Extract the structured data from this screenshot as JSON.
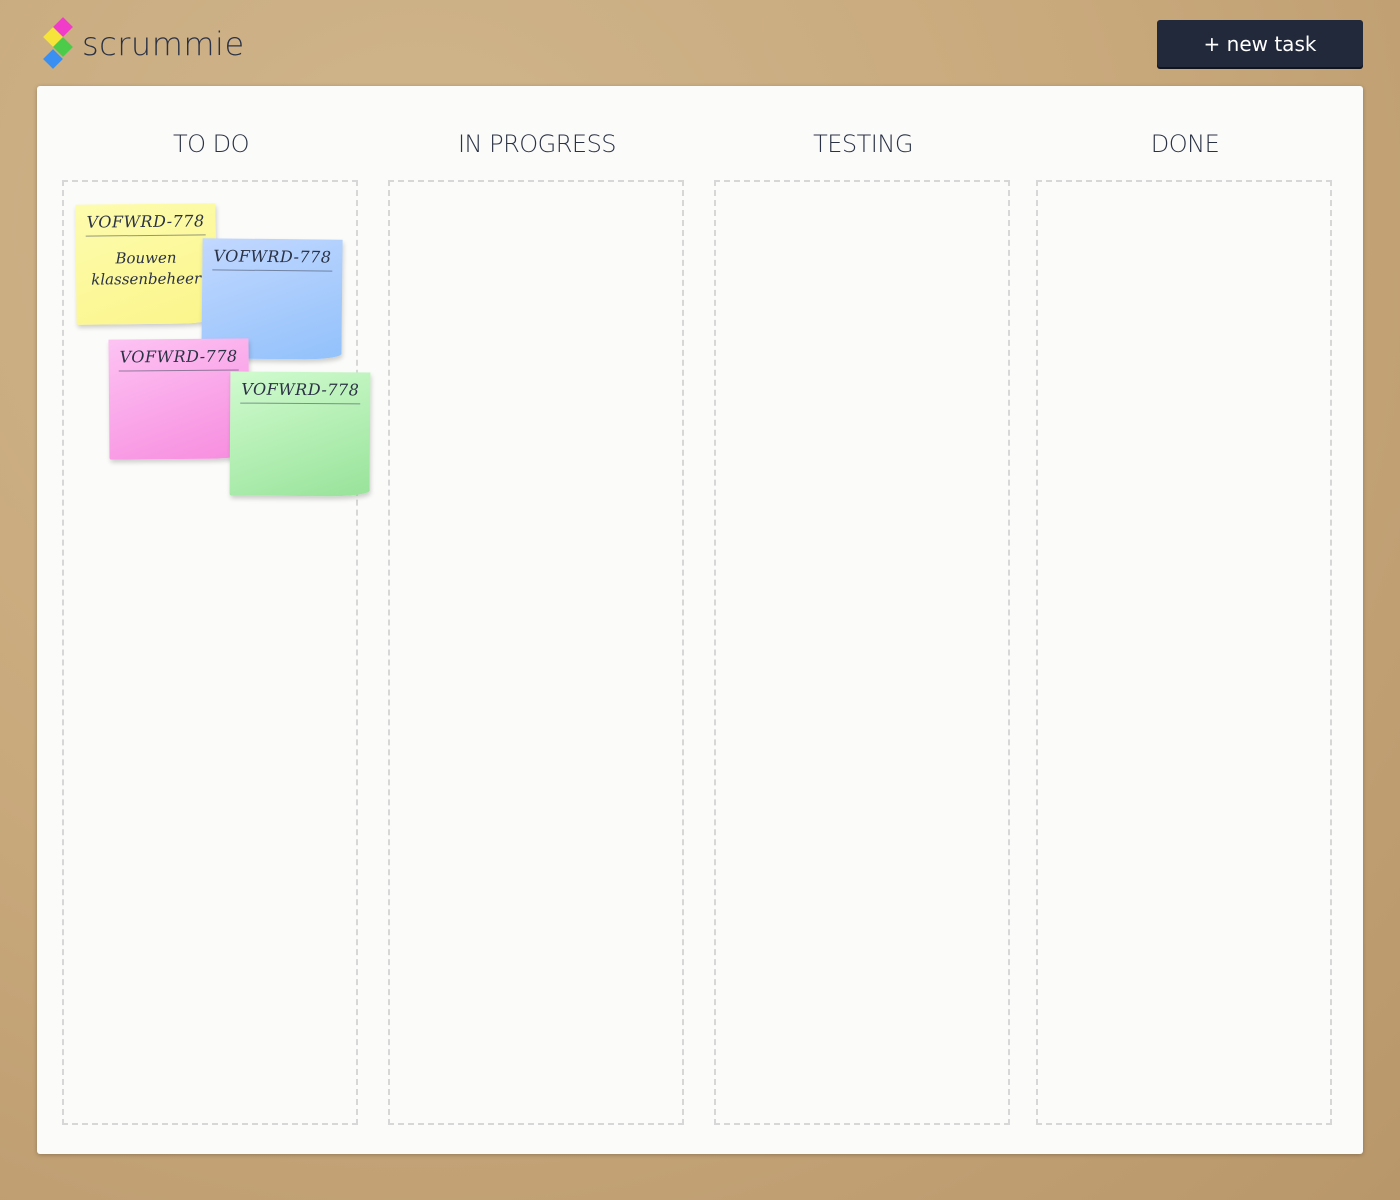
{
  "app": {
    "name": "scrummie",
    "new_task_label": "+ new task"
  },
  "columns": [
    {
      "title": "TO DO"
    },
    {
      "title": "IN PROGRESS"
    },
    {
      "title": "TESTING"
    },
    {
      "title": "DONE"
    }
  ],
  "notes": [
    {
      "id": "VOFWRD-778",
      "text": "Bouwen klassenbeheer",
      "color": "#fbf58a"
    },
    {
      "id": "VOFWRD-778",
      "text": "",
      "color": "#92c1fb"
    },
    {
      "id": "VOFWRD-778",
      "text": "",
      "color": "#f78cdf"
    },
    {
      "id": "VOFWRD-778",
      "text": "",
      "color": "#98e39a"
    }
  ],
  "colors": {
    "background": "#c8a97c",
    "button": "#22293b",
    "text": "#2b3245"
  }
}
